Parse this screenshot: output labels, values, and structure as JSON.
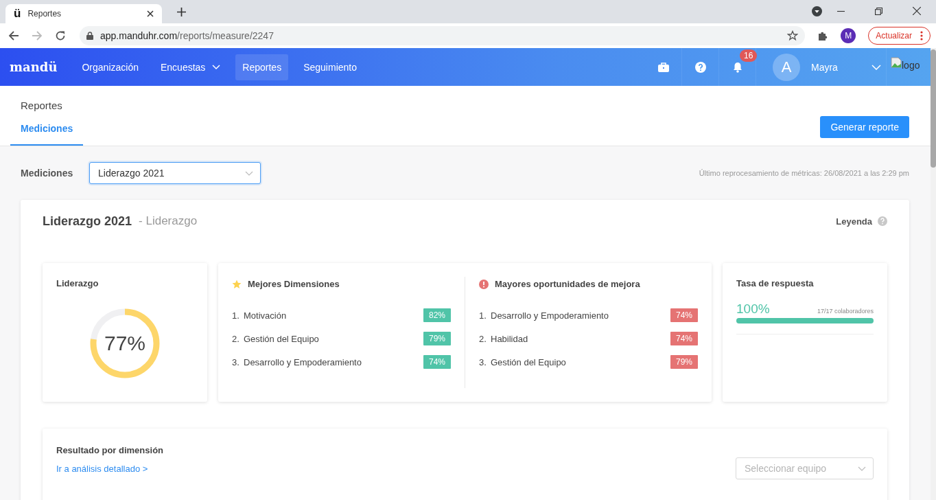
{
  "browser": {
    "favicon": "ü",
    "tab_title": "Reportes",
    "url_host": "app.manduhr.com",
    "url_path": "/reports/measure/2247",
    "profile_initial": "M",
    "update_button": "Actualizar"
  },
  "nav": {
    "logo": "mandü",
    "items": [
      {
        "label": "Organización",
        "selected": false,
        "dropdown": false
      },
      {
        "label": "Encuestas",
        "selected": false,
        "dropdown": true
      },
      {
        "label": "Reportes",
        "selected": true,
        "dropdown": false
      },
      {
        "label": "Seguimiento",
        "selected": false,
        "dropdown": false
      }
    ],
    "notification_count": "16",
    "avatar_letter": "A",
    "user_name": "Mayra",
    "logo_alt": "logo"
  },
  "header": {
    "title": "Reportes",
    "tabs": [
      {
        "label": "Mediciones",
        "selected": true
      }
    ],
    "generate_button": "Generar reporte"
  },
  "filter": {
    "label": "Mediciones",
    "value": "Liderazgo 2021",
    "last_update": "Último reprocesamiento de métricas: 26/08/2021 a las 2:29 pm"
  },
  "report": {
    "title": "Liderazgo 2021",
    "subtitle": "- Liderazgo",
    "legend": "Leyenda",
    "score": {
      "title": "Liderazgo",
      "value": "77%",
      "level": 0.77
    },
    "lists": [
      {
        "kind": "best",
        "title": "Mejores Dimensiones",
        "items": [
          {
            "rank": "1.",
            "name": "Motivación",
            "value": "82%"
          },
          {
            "rank": "2.",
            "name": "Gestión del Equipo",
            "value": "79%"
          },
          {
            "rank": "3.",
            "name": "Desarrollo y Empoderamiento",
            "value": "74%"
          }
        ]
      },
      {
        "kind": "improve",
        "title": "Mayores oportunidades de mejora",
        "items": [
          {
            "rank": "1.",
            "name": "Desarrollo y Empoderamiento",
            "value": "74%"
          },
          {
            "rank": "2.",
            "name": "Habilidad",
            "value": "74%"
          },
          {
            "rank": "3.",
            "name": "Gestión del Equipo",
            "value": "79%"
          }
        ]
      }
    ],
    "response": {
      "title": "Tasa de respuesta",
      "value": "100%",
      "detail": "17/17 colaboradores",
      "level": 1.0
    }
  },
  "results": {
    "title": "Resultado por dimensión",
    "link": "Ir a análisis detallado >",
    "team_placeholder": "Seleccionar equipo"
  }
}
